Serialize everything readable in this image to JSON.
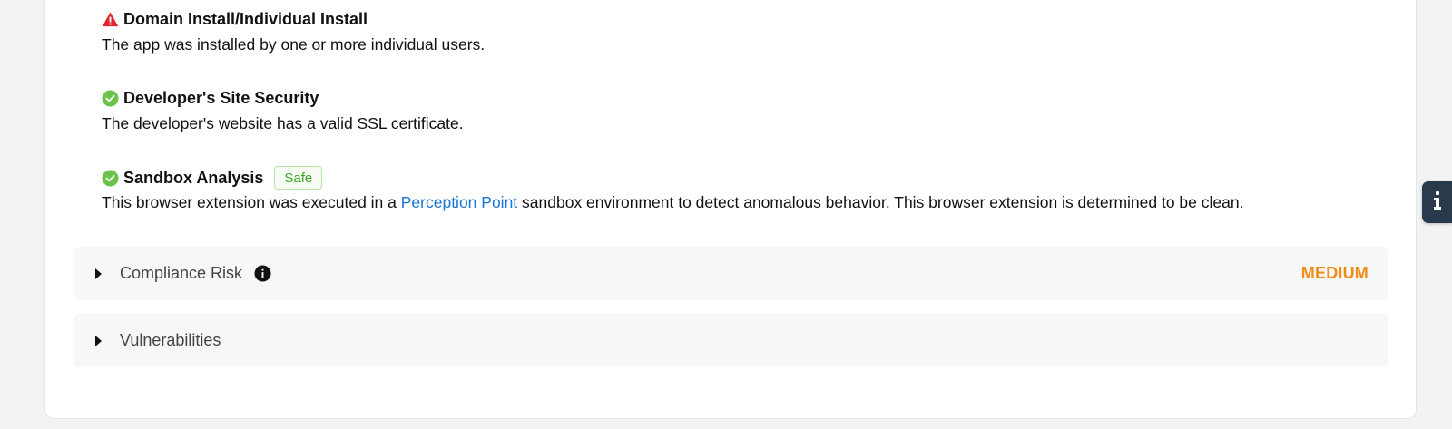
{
  "checks": [
    {
      "status": "warning",
      "icon": "warning-triangle-icon",
      "title": "Domain Install/Individual Install",
      "description": "The app was installed by one or more individual users."
    },
    {
      "status": "pass",
      "icon": "check-circle-icon",
      "title": "Developer's Site Security",
      "description": "The developer's website has a valid SSL certificate."
    },
    {
      "status": "pass",
      "icon": "check-circle-icon",
      "title": "Sandbox Analysis",
      "badge": "Safe",
      "description_before": "This browser extension was executed in a ",
      "link_text": "Perception Point",
      "description_after": " sandbox environment to detect anomalous behavior. This browser extension is determined to be clean."
    }
  ],
  "sections": [
    {
      "label": "Compliance Risk",
      "has_info": true,
      "level": "MEDIUM",
      "level_color": "#f28c14"
    },
    {
      "label": "Vulnerabilities",
      "has_info": false
    }
  ],
  "side_tab": {
    "icon": "info-icon"
  },
  "colors": {
    "warning": "#e0262c",
    "pass": "#6cc24a",
    "link": "#1a73d9",
    "medium": "#f28c14",
    "side_tab": "#2a3a4d"
  }
}
